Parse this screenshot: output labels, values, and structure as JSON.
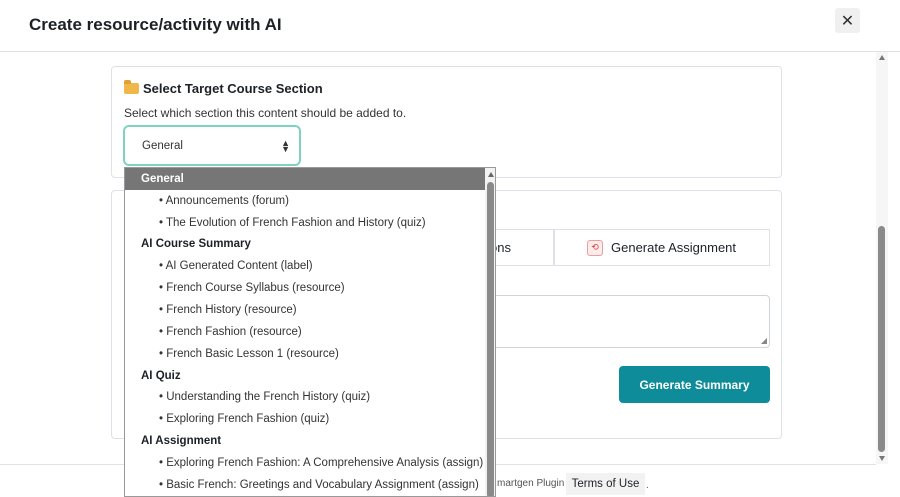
{
  "modal": {
    "title": "Create resource/activity with AI",
    "close_label": "✕"
  },
  "section_card": {
    "title": "Select Target Course Section",
    "description": "Select which section this content should be added to.",
    "selected_value": "General"
  },
  "tabs": {
    "partial_label": "ons",
    "assignment_label": "Generate Assignment"
  },
  "generate_button_label": "Generate Summary",
  "footer": {
    "plugin_text": "martgen Plugin",
    "terms_label": "Terms of Use",
    "trailing": "."
  },
  "dropdown": {
    "items": [
      {
        "type": "group",
        "label": "General",
        "selected": true
      },
      {
        "type": "child",
        "label": "• Announcements (forum)"
      },
      {
        "type": "child",
        "label": "• The Evolution of French Fashion and History (quiz)"
      },
      {
        "type": "group",
        "label": "AI Course Summary"
      },
      {
        "type": "child",
        "label": "• AI Generated Content (label)"
      },
      {
        "type": "child",
        "label": "• French Course Syllabus (resource)"
      },
      {
        "type": "child",
        "label": "• French History (resource)"
      },
      {
        "type": "child",
        "label": "• French Fashion (resource)"
      },
      {
        "type": "child",
        "label": "• French Basic Lesson 1 (resource)"
      },
      {
        "type": "group",
        "label": "AI Quiz"
      },
      {
        "type": "child",
        "label": "• Understanding the French History (quiz)"
      },
      {
        "type": "child",
        "label": "• Exploring French Fashion (quiz)"
      },
      {
        "type": "group",
        "label": "AI Assignment"
      },
      {
        "type": "child",
        "label": "• Exploring French Fashion: A Comprehensive Analysis (assign)"
      },
      {
        "type": "child",
        "label": "• Basic French: Greetings and Vocabulary Assignment (assign)"
      }
    ]
  },
  "colors": {
    "accent": "#0f8c9a",
    "select_border": "#7dd3c0",
    "dropdown_selected": "#767676"
  }
}
